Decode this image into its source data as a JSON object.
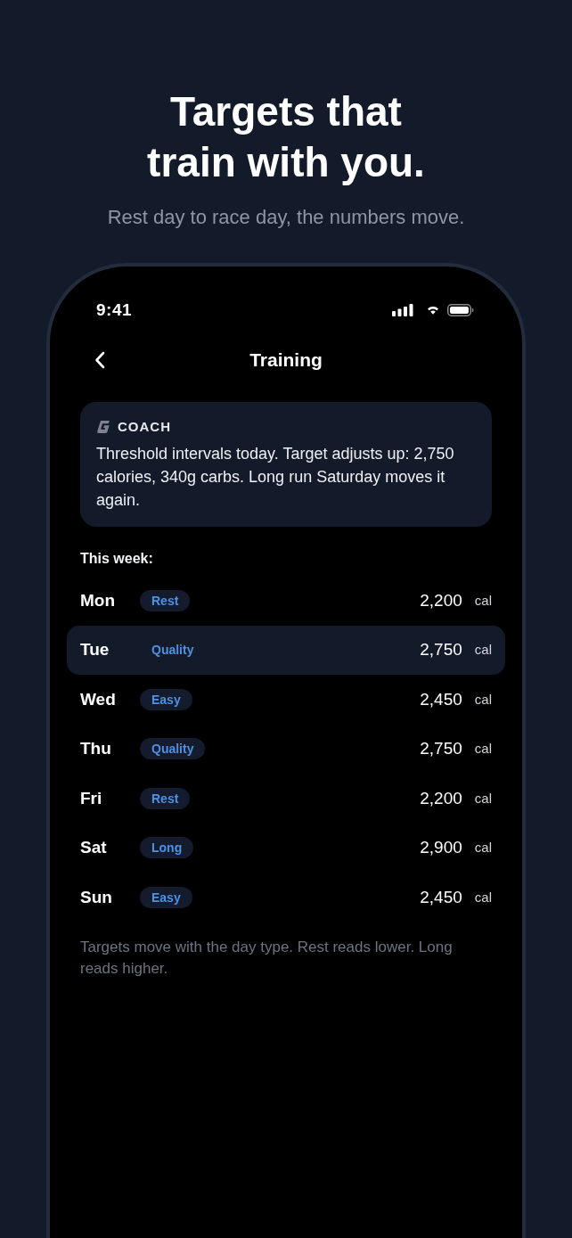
{
  "hero": {
    "title": "Targets that train with you.",
    "subtitle": "Rest day to race day, the numbers move."
  },
  "status_bar": {
    "time": "9:41"
  },
  "nav": {
    "title": "Training"
  },
  "coach": {
    "label": "COACH",
    "message": "Threshold intervals today. Target adjusts up: 2,750 calories, 340g carbs. Long run Saturday moves it again."
  },
  "week": {
    "heading": "This week:",
    "days": [
      {
        "day": "Mon",
        "type": "Rest",
        "calories": "2,200",
        "unit": "cal",
        "selected": false
      },
      {
        "day": "Tue",
        "type": "Quality",
        "calories": "2,750",
        "unit": "cal",
        "selected": true
      },
      {
        "day": "Wed",
        "type": "Easy",
        "calories": "2,450",
        "unit": "cal",
        "selected": false
      },
      {
        "day": "Thu",
        "type": "Quality",
        "calories": "2,750",
        "unit": "cal",
        "selected": false
      },
      {
        "day": "Fri",
        "type": "Rest",
        "calories": "2,200",
        "unit": "cal",
        "selected": false
      },
      {
        "day": "Sat",
        "type": "Long",
        "calories": "2,900",
        "unit": "cal",
        "selected": false
      },
      {
        "day": "Sun",
        "type": "Easy",
        "calories": "2,450",
        "unit": "cal",
        "selected": false
      }
    ]
  },
  "footnote": "Targets move with the day type. Rest reads lower. Long reads higher."
}
